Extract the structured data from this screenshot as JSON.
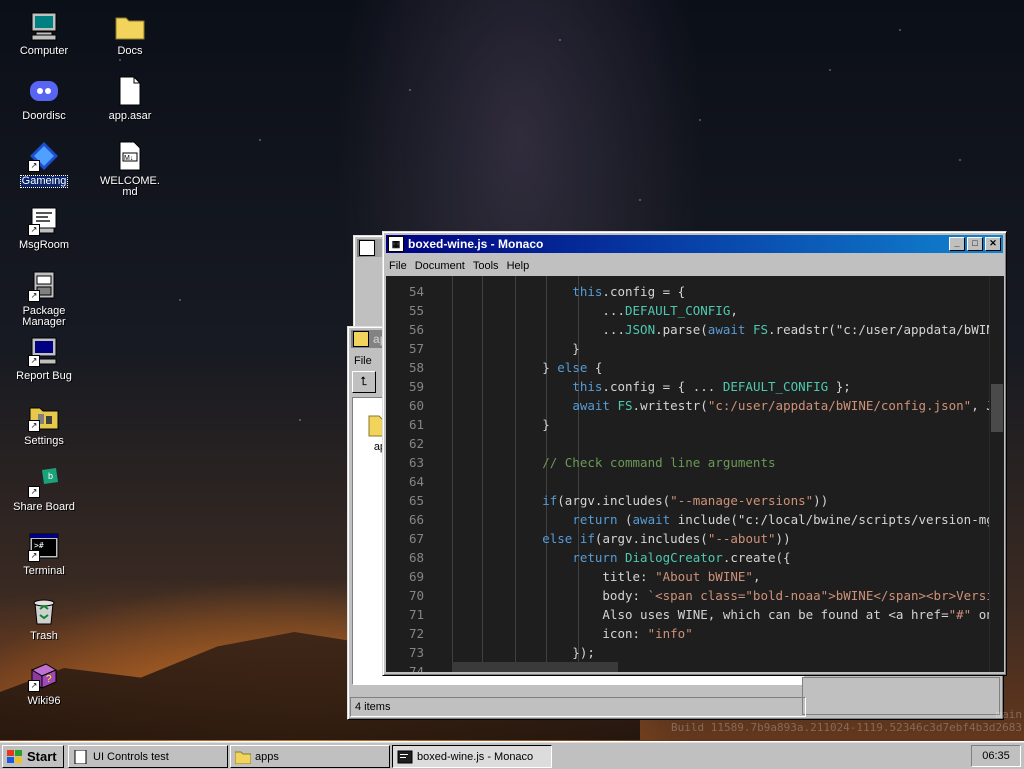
{
  "desktop": {
    "icons": [
      {
        "label": "Computer",
        "icon": "computer-icon"
      },
      {
        "label": "Doordisc",
        "icon": "discord-icon"
      },
      {
        "label": "Gameing",
        "icon": "game-icon"
      },
      {
        "label": "MsgRoom",
        "icon": "msgroom-icon"
      },
      {
        "label": "Package Manager",
        "icon": "package-icon"
      },
      {
        "label": "Report Bug",
        "icon": "report-bug-icon"
      },
      {
        "label": "Settings",
        "icon": "settings-icon"
      },
      {
        "label": "Share Board",
        "icon": "share-board-icon"
      },
      {
        "label": "Terminal",
        "icon": "terminal-icon"
      },
      {
        "label": "Trash",
        "icon": "trash-icon"
      },
      {
        "label": "Wiki96",
        "icon": "wiki-icon"
      },
      {
        "label": "Docs",
        "icon": "folder-icon"
      },
      {
        "label": "app.asar",
        "icon": "file-icon"
      },
      {
        "label": "WELCOME.md",
        "icon": "markdown-icon"
      }
    ],
    "build_text": "Build 11589.7b9a893a.211024-1119.52346c3d7ebf4b3d2683",
    "build_text_partial": "main"
  },
  "explorer": {
    "title": "apps",
    "menu": [
      "File"
    ],
    "folder_label": "app",
    "status": "4 items"
  },
  "monaco": {
    "title": "boxed-wine.js - Monaco",
    "menu": [
      "File",
      "Document",
      "Tools",
      "Help"
    ],
    "lines": [
      {
        "n": "54",
        "text": "            this.config = {"
      },
      {
        "n": "55",
        "text": "                ...DEFAULT_CONFIG,"
      },
      {
        "n": "56",
        "text": "                ...JSON.parse(await FS.readstr(\"c:/user/appdata/bWINE."
      },
      {
        "n": "57",
        "text": "            }"
      },
      {
        "n": "58",
        "text": "        } else {"
      },
      {
        "n": "59",
        "text": "            this.config = { ... DEFAULT_CONFIG };"
      },
      {
        "n": "60",
        "text": "            await FS.writestr(\"c:/user/appdata/bWINE/config.json\", JSO"
      },
      {
        "n": "61",
        "text": "        }"
      },
      {
        "n": "62",
        "text": ""
      },
      {
        "n": "63",
        "text": "        // Check command line arguments"
      },
      {
        "n": "64",
        "text": ""
      },
      {
        "n": "65",
        "text": "        if(argv.includes(\"--manage-versions\"))"
      },
      {
        "n": "66",
        "text": "            return (await include(\"c:/local/bwine/scripts/version-mgr"
      },
      {
        "n": "67",
        "text": "        else if(argv.includes(\"--about\"))"
      },
      {
        "n": "68",
        "text": "            return DialogCreator.create({"
      },
      {
        "n": "69",
        "text": "                title: \"About bWINE\","
      },
      {
        "n": "70",
        "text": "                body: `<span class=\"bold-noaa\">bWINE</span><br>Version"
      },
      {
        "n": "71",
        "text": "                Also uses WINE, which can be found at <a href=\"#\" oncl"
      },
      {
        "n": "72",
        "text": "                icon: \"info\""
      },
      {
        "n": "73",
        "text": "            });"
      },
      {
        "n": "74",
        "text": ""
      }
    ]
  },
  "taskbar": {
    "start": "Start",
    "tasks": [
      {
        "label": "UI Controls test",
        "icon": "window-icon"
      },
      {
        "label": "apps",
        "icon": "folder-icon"
      },
      {
        "label": "boxed-wine.js - Monaco",
        "icon": "monaco-icon"
      }
    ],
    "clock": "06:35"
  }
}
